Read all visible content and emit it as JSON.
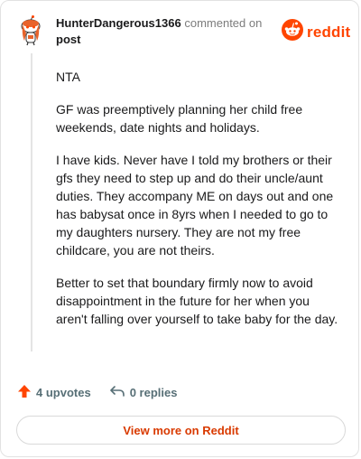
{
  "comment": {
    "username": "HunterDangerous1366",
    "commented_text": "commented on",
    "post_label": "post",
    "paragraphs": [
      "NTA",
      "GF was preemptively planning her child free weekends, date nights and holidays.",
      "I have kids. Never have I told my brothers or their gfs they need to step up and do their uncle/aunt duties. They accompany ME on days out and one has babysat once in 8yrs when I needed to go to my daughters nursery. They are not my free childcare, you are not theirs.",
      "Better to set that boundary firmly now to avoid disappointment in the future for her when you aren't falling over yourself to take baby for the day."
    ]
  },
  "brand": {
    "wordmark": "reddit",
    "color": "#ff4500"
  },
  "actions": {
    "upvotes_label": "4 upvotes",
    "replies_label": "0 replies"
  },
  "footer": {
    "view_more_label": "View more on Reddit"
  },
  "icons": {
    "avatar": "avatar-icon",
    "logo": "reddit-logo-icon",
    "upvote": "upvote-arrow-icon",
    "reply": "reply-arrow-icon"
  }
}
